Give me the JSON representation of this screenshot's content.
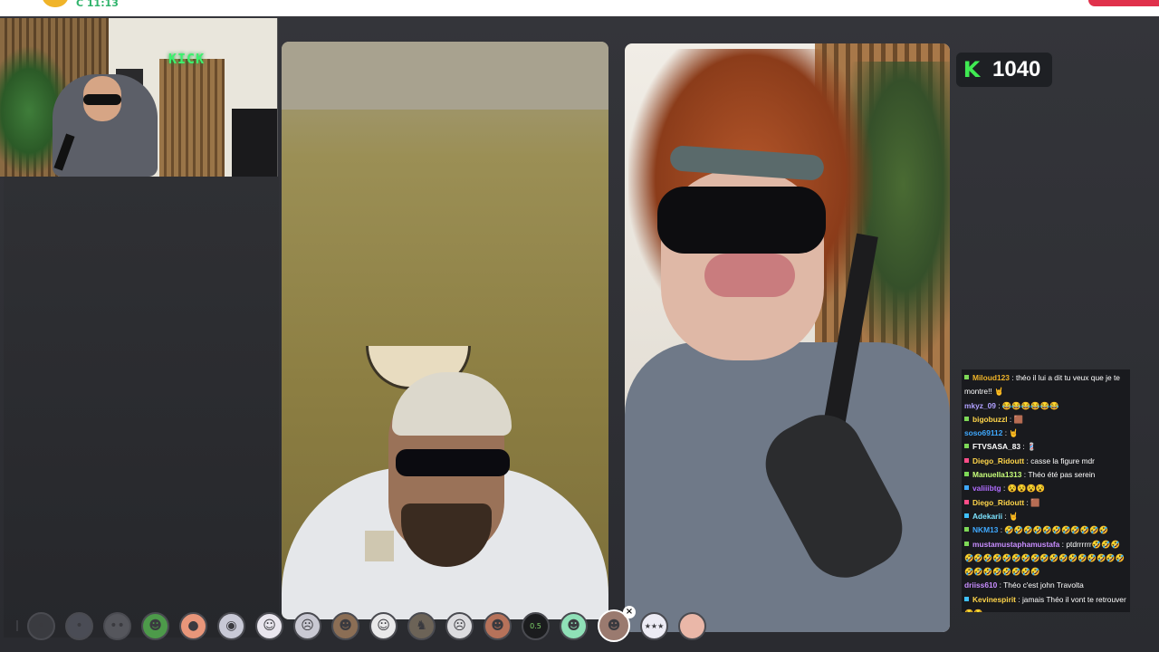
{
  "topbar": {
    "logo_text": "C 11:13"
  },
  "kick": {
    "count": "1040",
    "icon_letter": "K",
    "brand_color": "#3fea52"
  },
  "webcam": {
    "sign_text": "KICK"
  },
  "chat": {
    "messages": [
      {
        "user": "Miloud123",
        "color": "#f0b429",
        "badge": "#7ed957",
        "text": "théo il lui a dit tu veux que je te montre!! 🤘"
      },
      {
        "user": "mkyz_09",
        "color": "#b0a0ff",
        "badge": "",
        "text": "😂😂😂😂😂😂"
      },
      {
        "user": "bigobuzzl",
        "color": "#ffd54a",
        "badge": "#7ed957",
        "text": "🟫"
      },
      {
        "user": "soso69112",
        "color": "#3fa9ff",
        "badge": "",
        "text": "🤘"
      },
      {
        "user": "FTVSASA_83",
        "color": "#ffffff",
        "badge": "#7ed957",
        "text": "💈"
      },
      {
        "user": "Diego_Ridoutt",
        "color": "#ffd54a",
        "badge": "#ff4d88",
        "text": "casse la figure mdr"
      },
      {
        "user": "Manuella1313",
        "color": "#c8ff7a",
        "badge": "#7ed957",
        "text": "Théo été pas serein"
      },
      {
        "user": "valiiibtg",
        "color": "#b06cff",
        "badge": "#3fa9ff",
        "text": "😵😵😵😵"
      },
      {
        "user": "Diego_Ridoutt",
        "color": "#ffd54a",
        "badge": "#ff4d88",
        "text": "🟫"
      },
      {
        "user": "Adekarii",
        "color": "#7ce3ff",
        "badge": "#3fc1ff",
        "text": "🤘"
      },
      {
        "user": "NKM13",
        "color": "#3fa9ff",
        "badge": "#7ed957",
        "text": "🤣🤣🤣🤣🤣🤣🤣🤣🤣🤣🤣"
      },
      {
        "user": "mustamustaphamustafa",
        "color": "#c88dff",
        "badge": "#7ed957",
        "text": "ptdrrrrrr🤣🤣🤣🤣🤣🤣🤣🤣🤣🤣🤣🤣🤣🤣🤣🤣🤣🤣🤣🤣🤣🤣🤣🤣🤣🤣🤣🤣"
      },
      {
        "user": "driiss610",
        "color": "#c88dff",
        "badge": "",
        "text": "Théo c'est john Travolta"
      },
      {
        "user": "Kevinespirit",
        "color": "#ffd54a",
        "badge": "#3fc1ff",
        "text": "jamais Théo il vont te retrouver 😂😂"
      }
    ]
  },
  "reactions": [
    {
      "name": "reaction-1",
      "glyph": "•",
      "bg": "#3a3b40"
    },
    {
      "name": "reaction-2",
      "glyph": "•",
      "bg": "#4a4c55"
    },
    {
      "name": "reaction-3",
      "glyph": "••",
      "bg": "#55565c"
    },
    {
      "name": "reaction-4",
      "glyph": "☻",
      "bg": "#4d9a4a"
    },
    {
      "name": "reaction-5",
      "glyph": "●",
      "bg": "#e8967a"
    },
    {
      "name": "reaction-6",
      "glyph": "◉",
      "bg": "#c8c9d6"
    },
    {
      "name": "reaction-7",
      "glyph": "☺",
      "bg": "#e9e6ee"
    },
    {
      "name": "reaction-8",
      "glyph": "☹",
      "bg": "#c9c9d3"
    },
    {
      "name": "reaction-9",
      "glyph": "☻",
      "bg": "#8b6e55"
    },
    {
      "name": "reaction-10",
      "glyph": "☺",
      "bg": "#e9e9ea"
    },
    {
      "name": "reaction-11",
      "glyph": "♞",
      "bg": "#6c6357"
    },
    {
      "name": "reaction-12",
      "glyph": "☹",
      "bg": "#dcdcdf"
    },
    {
      "name": "reaction-13",
      "glyph": "☻",
      "bg": "#b6725a"
    },
    {
      "name": "reaction-14",
      "glyph": "0.5",
      "bg": "#1b1c1e"
    },
    {
      "name": "reaction-15",
      "glyph": "☻",
      "bg": "#8fe0b7"
    },
    {
      "name": "reaction-16",
      "glyph": "☻",
      "bg": "#9a7a6f",
      "active": true
    },
    {
      "name": "reaction-17",
      "glyph": "★★★",
      "bg": "#ecebf4"
    },
    {
      "name": "reaction-18",
      "glyph": "",
      "bg": "#eab7a8"
    }
  ]
}
